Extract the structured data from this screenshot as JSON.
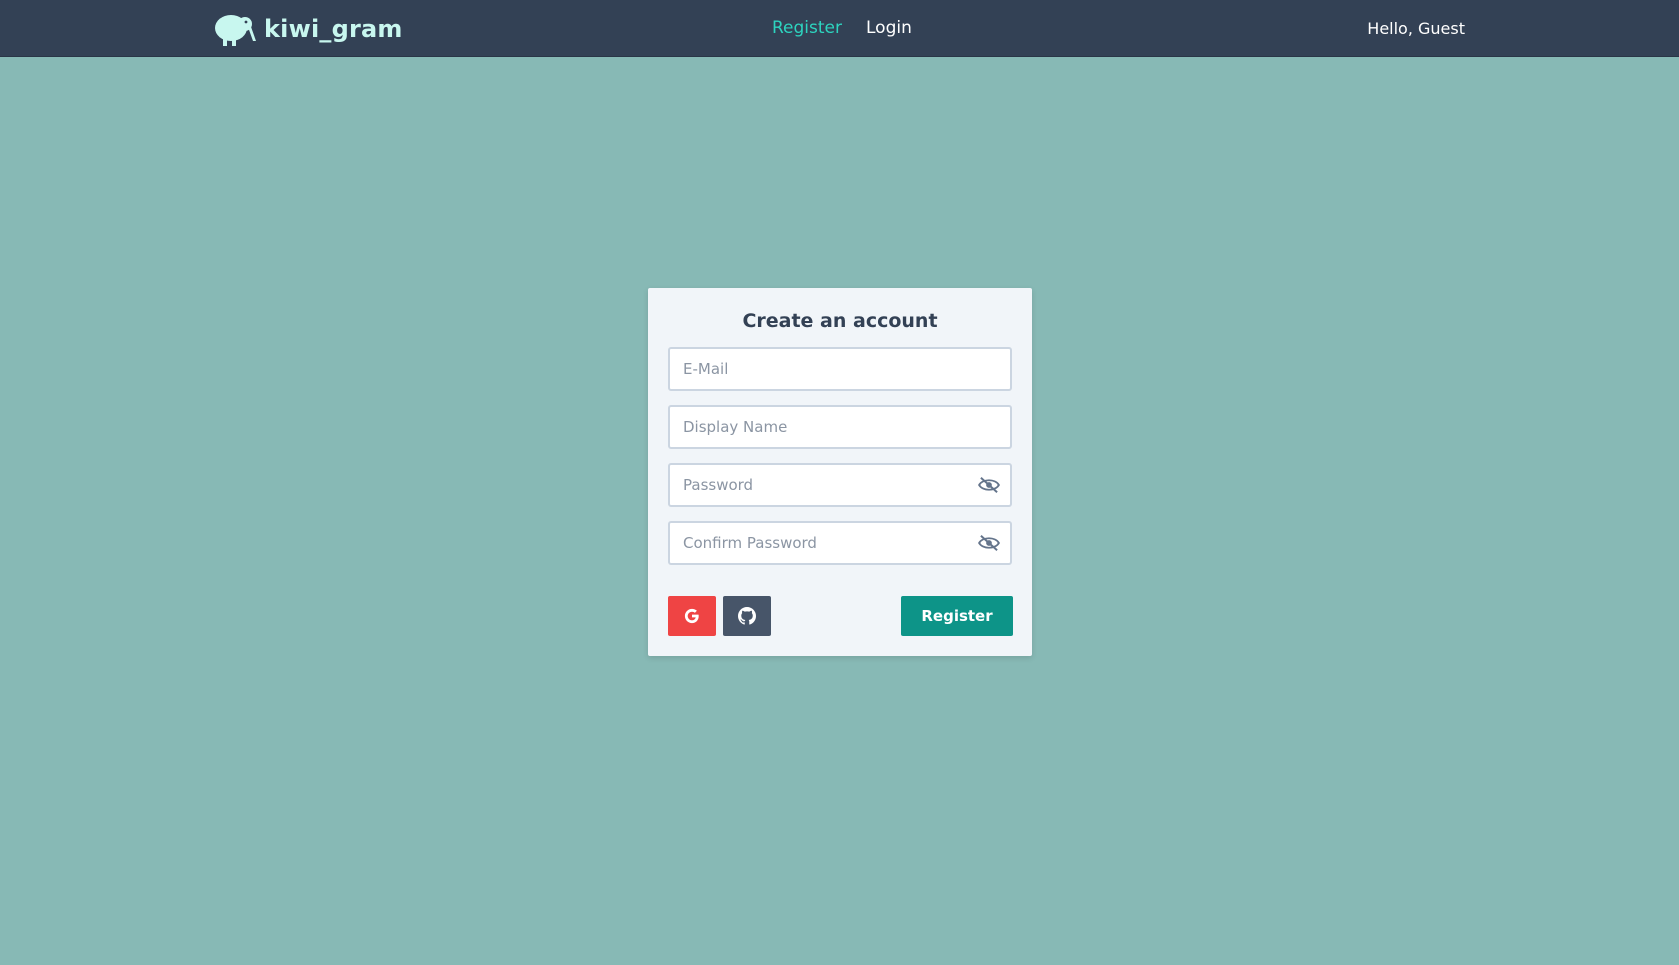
{
  "navbar": {
    "brand_name": "kiwi_gram",
    "brand_icon": "kiwi-bird-icon",
    "links": [
      {
        "label": "Register",
        "active": true
      },
      {
        "label": "Login",
        "active": false
      }
    ],
    "greeting": "Hello, Guest"
  },
  "form": {
    "title": "Create an account",
    "fields": {
      "email": {
        "placeholder": "E-Mail",
        "value": ""
      },
      "display_name": {
        "placeholder": "Display Name",
        "value": ""
      },
      "password": {
        "placeholder": "Password",
        "value": "",
        "icon": "eye-slash-icon"
      },
      "confirm_password": {
        "placeholder": "Confirm Password",
        "value": "",
        "icon": "eye-slash-icon"
      }
    },
    "google_icon": "google-icon",
    "github_icon": "github-icon",
    "register_label": "Register"
  },
  "colors": {
    "background": "#87b9b5",
    "navbar": "#334155",
    "brand": "#c8f7ef",
    "active_link": "#2dd4bf",
    "google": "#ef4444",
    "github": "#475569",
    "register": "#0d9488"
  }
}
